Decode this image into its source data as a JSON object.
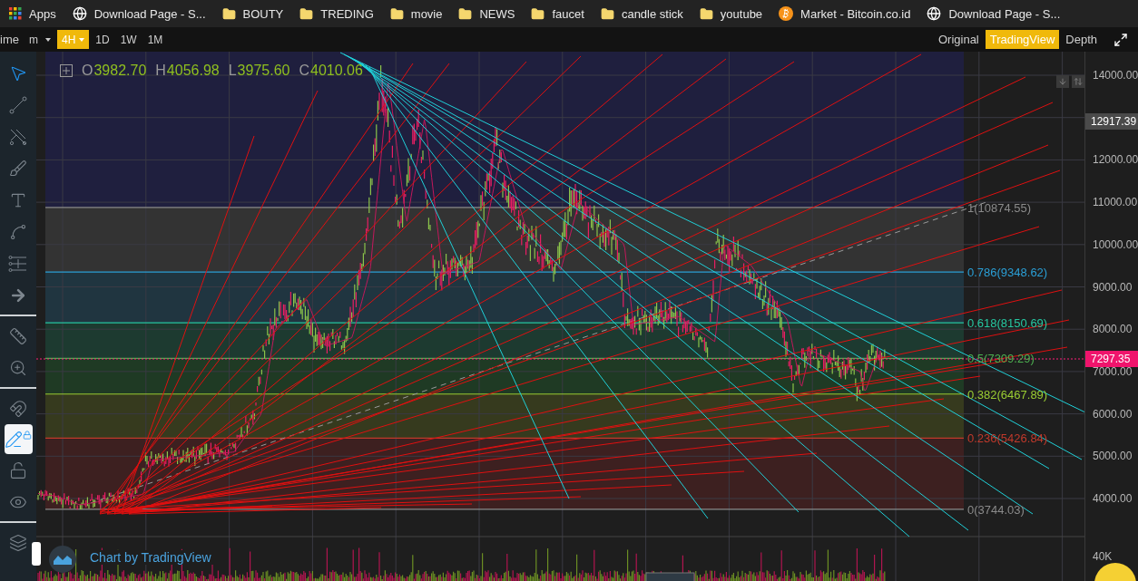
{
  "bookmarks": [
    {
      "kind": "apps",
      "label": "Apps"
    },
    {
      "kind": "page",
      "label": "Download Page - S..."
    },
    {
      "kind": "folder",
      "label": "BOUTY"
    },
    {
      "kind": "folder",
      "label": "TREDING"
    },
    {
      "kind": "folder",
      "label": "movie"
    },
    {
      "kind": "folder",
      "label": "NEWS"
    },
    {
      "kind": "folder",
      "label": "faucet"
    },
    {
      "kind": "folder",
      "label": "candle stick"
    },
    {
      "kind": "folder",
      "label": "youtube"
    },
    {
      "kind": "coin",
      "label": "Market - Bitcoin.co.id"
    },
    {
      "kind": "page",
      "label": "Download Page - S..."
    }
  ],
  "toolbar": {
    "time_label": "ime",
    "unit": "m",
    "intervals": [
      {
        "label": "4H",
        "selected": true,
        "dropdown": true
      },
      {
        "label": "1D",
        "selected": false,
        "dropdown": false
      },
      {
        "label": "1W",
        "selected": false,
        "dropdown": false
      },
      {
        "label": "1M",
        "selected": false,
        "dropdown": false
      }
    ],
    "views": [
      {
        "label": "Original",
        "selected": false
      },
      {
        "label": "TradingView",
        "selected": true
      },
      {
        "label": "Depth",
        "selected": false
      }
    ]
  },
  "tools": [
    {
      "kind": "cursor",
      "selected": false
    },
    {
      "kind": "line",
      "selected": false
    },
    {
      "kind": "fork",
      "selected": false
    },
    {
      "kind": "brush",
      "selected": false
    },
    {
      "kind": "text",
      "selected": false
    },
    {
      "kind": "pattern",
      "selected": false
    },
    {
      "kind": "fib",
      "selected": false
    },
    {
      "kind": "arrow",
      "selected": false
    },
    {
      "kind": "divider"
    },
    {
      "kind": "ruler",
      "selected": false
    },
    {
      "kind": "zoom",
      "selected": false
    },
    {
      "kind": "divider"
    },
    {
      "kind": "magnet",
      "selected": false
    },
    {
      "kind": "lock-draw",
      "selected": true
    },
    {
      "kind": "unlock",
      "selected": false
    },
    {
      "kind": "eye",
      "selected": false
    },
    {
      "kind": "divider"
    },
    {
      "kind": "layers",
      "selected": false
    }
  ],
  "ohlc": [
    {
      "key": "O",
      "value": "3982.70"
    },
    {
      "key": "H",
      "value": "4056.98"
    },
    {
      "key": "L",
      "value": "3975.60"
    },
    {
      "key": "C",
      "value": "4010.06"
    }
  ],
  "fib_levels": [
    {
      "label": "1(10874.55)",
      "color": "#8a8a8a"
    },
    {
      "label": "0.786(9348.62)",
      "color": "#2a9fd6"
    },
    {
      "label": "0.618(8150.69)",
      "color": "#26c6a0"
    },
    {
      "label": "0.5(7309.29)",
      "color": "#4caf50"
    },
    {
      "label": "0.382(6467.89)",
      "color": "#9acd32"
    },
    {
      "label": "0.236(5426.84)",
      "color": "#c0392b"
    },
    {
      "label": "0(3744.03)",
      "color": "#8a8a8a"
    }
  ],
  "price_axis": {
    "labels": [
      "14000.00",
      "12000.00",
      "11000.00",
      "10000.00",
      "9000.00",
      "8000.00",
      "7000.00",
      "6000.00",
      "5000.00",
      "4000.00"
    ],
    "marker": "12917.39",
    "last_price": "7297.35",
    "volume_label": "40K"
  },
  "footer": {
    "credit": "Chart by TradingView"
  }
}
